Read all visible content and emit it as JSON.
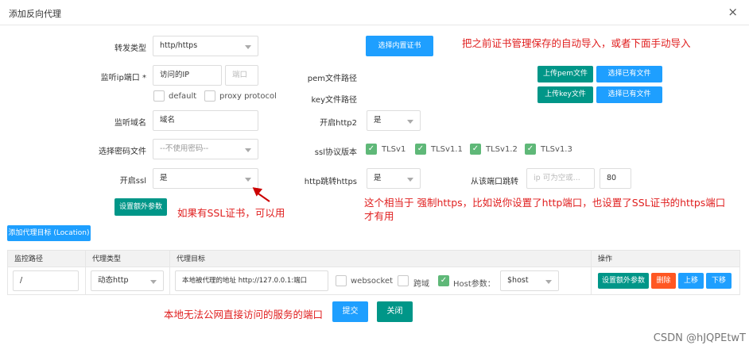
{
  "dialog": {
    "title": "添加反向代理",
    "close_icon": "×"
  },
  "form": {
    "forward_type": {
      "label": "转发类型",
      "value": "http/https"
    },
    "choose_cert_button": "选择内置证书",
    "listen_port": {
      "label": "监听ip端口",
      "required_mark": "*",
      "ip_value": "访问的IP",
      "port_placeholder": "端口",
      "default_label": "default",
      "proxy_protocol_label": "proxy protocol"
    },
    "pem_label": "pem文件路径",
    "key_label": "key文件路径",
    "upload_pem_button": "上传pem文件",
    "upload_key_button": "上传key文件",
    "select_existing_1": "选择已有文件",
    "select_existing_2": "选择已有文件",
    "listen_domain": {
      "label": "监听域名",
      "value": "域名"
    },
    "http2": {
      "label": "开启http2",
      "value": "是"
    },
    "cipher_file": {
      "label": "选择密码文件",
      "value": "--不使用密码--"
    },
    "ssl_protocol": {
      "label": "ssl协议版本",
      "options": [
        "TLSv1",
        "TLSv1.1",
        "TLSv1.2",
        "TLSv1.3"
      ]
    },
    "enable_ssl": {
      "label": "开启ssl",
      "value": "是"
    },
    "http_redirect": {
      "label": "http跳转https",
      "value": "是"
    },
    "redirect_port": {
      "label": "从该端口跳转",
      "placeholder": "ip 可为空或...",
      "port": "80"
    },
    "extra_params_button": "设置额外参数",
    "add_target_button": "添加代理目标 (Location)"
  },
  "annotations": {
    "auto_import": "把之前证书管理保存的自动导入，或者下面手动导入",
    "ssl_note": "如果有SSL证书，可以用",
    "force_https": "这个相当于 强制https，比如说你设置了http端口，也设置了SSL证书的https端口",
    "force_https_2": "才有用",
    "no_public": "本地无法公网直接访问的服务的端口"
  },
  "table": {
    "headers": [
      "监控路径",
      "代理类型",
      "代理目标",
      "操作"
    ],
    "row": {
      "path": "/",
      "type": "动态http",
      "target": "本地被代理的地址 http://127.0.0.1:端口",
      "websocket": "websocket",
      "cross_domain": "跨域",
      "host_param": "Host参数：",
      "host_value": "$host",
      "actions": [
        "设置额外参数",
        "删除",
        "上移",
        "下移"
      ]
    }
  },
  "footer": {
    "submit": "提交",
    "close": "关闭"
  },
  "watermark": "CSDN @hJQPEtwT"
}
